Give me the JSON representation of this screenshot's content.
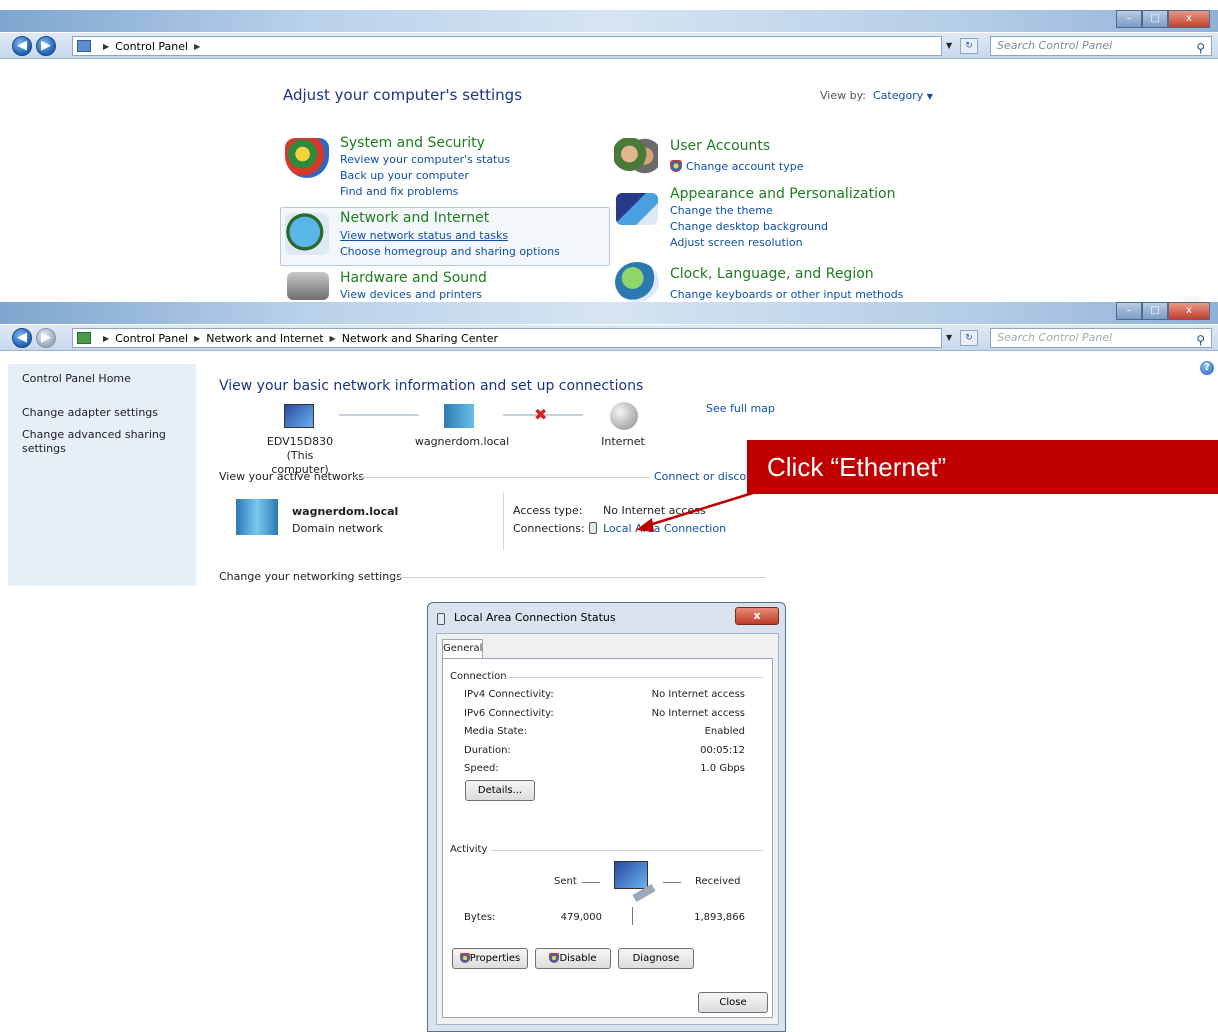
{
  "window1": {
    "breadcrumb": [
      "Control Panel"
    ],
    "search_placeholder": "Search Control Panel",
    "heading": "Adjust your computer's settings",
    "view_by_label": "View by:",
    "view_by_value": "Category",
    "categories_left": [
      {
        "title": "System and Security",
        "links": [
          "Review your computer's status",
          "Back up your computer",
          "Find and fix problems"
        ]
      },
      {
        "title": "Network and Internet",
        "links": [
          "View network status and tasks",
          "Choose homegroup and sharing options"
        ]
      },
      {
        "title": "Hardware and Sound",
        "links": [
          "View devices and printers"
        ]
      }
    ],
    "categories_right": [
      {
        "title": "User Accounts",
        "links": [
          "Change account type"
        ]
      },
      {
        "title": "Appearance and Personalization",
        "links": [
          "Change the theme",
          "Change desktop background",
          "Adjust screen resolution"
        ]
      },
      {
        "title": "Clock, Language, and Region",
        "links": [
          "Change keyboards or other input methods"
        ]
      }
    ]
  },
  "window2": {
    "breadcrumb": [
      "Control Panel",
      "Network and Internet",
      "Network and Sharing Center"
    ],
    "search_placeholder": "Search Control Panel",
    "sidebar": [
      "Control Panel Home",
      "Change adapter settings",
      "Change advanced sharing settings"
    ],
    "heading": "View your basic network information and set up connections",
    "see_full_map": "See full map",
    "map_nodes": [
      {
        "name": "EDV15D830",
        "sub": "(This computer)"
      },
      {
        "name": "wagnerdom.local",
        "sub": ""
      },
      {
        "name": "Internet",
        "sub": ""
      }
    ],
    "active_networks_label": "View your active networks",
    "connect_link": "Connect or discon",
    "network_name": "wagnerdom.local",
    "network_type": "Domain network",
    "access_type_label": "Access type:",
    "access_type_value": "No Internet access",
    "connections_label": "Connections:",
    "connections_value": "Local Area Connection",
    "change_settings_label": "Change your networking settings"
  },
  "callout": {
    "text": "Click “Ethernet”",
    "color": "#c00000"
  },
  "dialog": {
    "title": "Local Area Connection Status",
    "close_glyph": "x",
    "tab": "General",
    "connection_group": "Connection",
    "rows": [
      {
        "label": "IPv4 Connectivity:",
        "value": "No Internet access"
      },
      {
        "label": "IPv6 Connectivity:",
        "value": "No Internet access"
      },
      {
        "label": "Media State:",
        "value": "Enabled"
      },
      {
        "label": "Duration:",
        "value": "00:05:12"
      },
      {
        "label": "Speed:",
        "value": "1.0 Gbps"
      }
    ],
    "details_button": "Details...",
    "activity_group": "Activity",
    "sent_label": "Sent",
    "received_label": "Received",
    "bytes_label": "Bytes:",
    "bytes_sent": "479,000",
    "bytes_received": "1,893,866",
    "properties_button": "Properties",
    "disable_button": "Disable",
    "diagnose_button": "Diagnose",
    "close_button": "Close"
  }
}
